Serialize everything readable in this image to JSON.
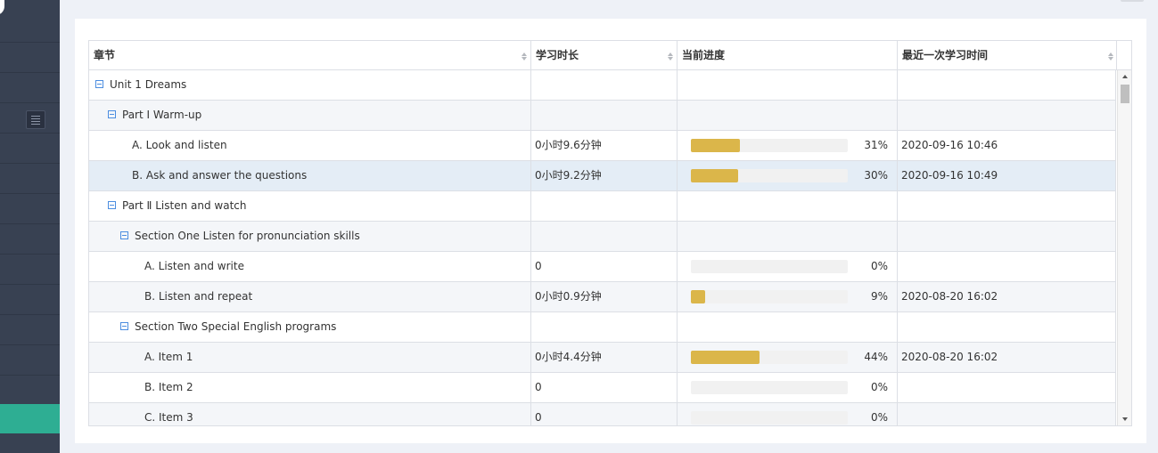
{
  "table": {
    "columns": [
      {
        "label": "章节",
        "sortable": true
      },
      {
        "label": "学习时长",
        "sortable": true
      },
      {
        "label": "当前进度",
        "sortable": false
      },
      {
        "label": "最近一次学习时间",
        "sortable": true
      }
    ],
    "rows": [
      {
        "title": "Unit 1 Dreams",
        "level": 0,
        "expanded": true,
        "duration": "",
        "progress": null,
        "pct": "",
        "last": ""
      },
      {
        "title": "Part Ⅰ Warm-up",
        "level": 1,
        "expanded": true,
        "duration": "",
        "progress": null,
        "pct": "",
        "last": ""
      },
      {
        "title": "A. Look and listen",
        "level": 2,
        "duration": "0小时9.6分钟",
        "progress": 31,
        "pct": "31%",
        "last": "2020-09-16 10:46"
      },
      {
        "title": "B. Ask and answer the questions",
        "level": 2,
        "selected": true,
        "duration": "0小时9.2分钟",
        "progress": 30,
        "pct": "30%",
        "last": "2020-09-16 10:49"
      },
      {
        "title": "Part Ⅱ Listen and watch",
        "level": 1,
        "expanded": true,
        "duration": "",
        "progress": null,
        "pct": "",
        "last": ""
      },
      {
        "title": "Section One Listen for pronunciation skills",
        "level": 2,
        "expanded": true,
        "duration": "",
        "progress": null,
        "pct": "",
        "last": ""
      },
      {
        "title": "A. Listen and write",
        "level": 3,
        "duration": "0",
        "progress": 0,
        "pct": "0%",
        "last": ""
      },
      {
        "title": "B. Listen and repeat",
        "level": 3,
        "duration": "0小时0.9分钟",
        "progress": 9,
        "pct": "9%",
        "last": "2020-08-20 16:02"
      },
      {
        "title": "Section Two Special English programs",
        "level": 2,
        "expanded": true,
        "duration": "",
        "progress": null,
        "pct": "",
        "last": ""
      },
      {
        "title": "A. Item 1",
        "level": 3,
        "duration": "0小时4.4分钟",
        "progress": 44,
        "pct": "44%",
        "last": "2020-08-20 16:02"
      },
      {
        "title": "B. Item 2",
        "level": 3,
        "duration": "0",
        "progress": 0,
        "pct": "0%",
        "last": ""
      },
      {
        "title": "C. Item 3",
        "level": 3,
        "duration": "0",
        "progress": 0,
        "pct": "0%",
        "last": ""
      }
    ]
  },
  "colors": {
    "sidebar_bg": "#384152",
    "sidebar_active": "#2eae93",
    "progress_fill": "#dbb64a",
    "progress_track": "#f1f1f1",
    "tree_toggle": "#4b8de0",
    "row_selected": "#e4edf6"
  },
  "icons": {
    "tree_toggle": "minus-square-icon",
    "sort": "sort-arrows-icon",
    "menu": "hamburger-menu-icon"
  }
}
